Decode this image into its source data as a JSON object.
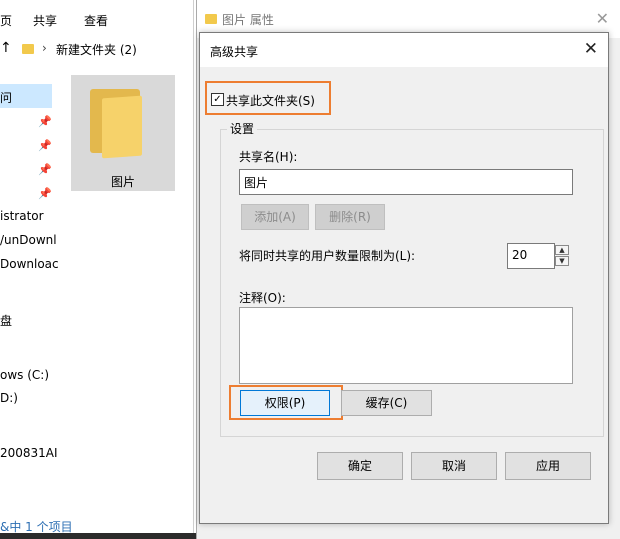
{
  "explorer": {
    "ribbon_tabs": [
      "页",
      "共享",
      "查看"
    ],
    "address": {
      "path": "新建文件夹 (2)"
    },
    "nav_items": [
      "问",
      "istrator",
      "/unDownl",
      "Downloac",
      "盘",
      "ows (C:)",
      "D:)",
      "200831AI"
    ],
    "folder": {
      "label": "图片"
    },
    "status": "&中 1 个项目"
  },
  "properties_window": {
    "title": "图片 属性"
  },
  "dialog": {
    "title": "高级共享",
    "share_checkbox": {
      "label": "共享此文件夹(S)",
      "checked": true,
      "mark": "✓"
    },
    "settings_group": "设置",
    "share_name_label": "共享名(H):",
    "share_name_value": "图片",
    "add_button": "添加(A)",
    "remove_button": "删除(R)",
    "limit_label": "将同时共享的用户数量限制为(L):",
    "limit_value": "20",
    "comment_label": "注释(O):",
    "comment_value": "",
    "permissions_button": "权限(P)",
    "caching_button": "缓存(C)",
    "ok_button": "确定",
    "cancel_button": "取消",
    "apply_button": "应用"
  },
  "colors": {
    "highlight_border": "#ed7d31",
    "folder": "#f6d26a",
    "selection": "#cce8ff"
  }
}
